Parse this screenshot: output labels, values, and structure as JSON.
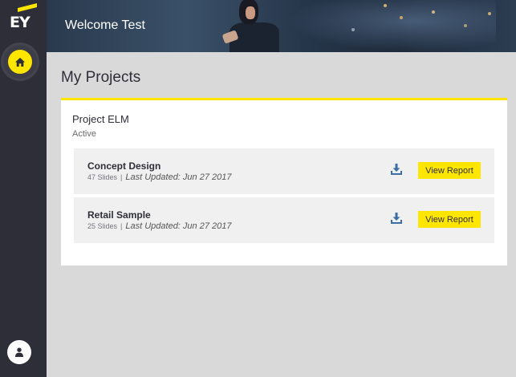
{
  "brand": {
    "logo_text": "EY",
    "accent_color": "#ffe600",
    "sidebar_color": "#2e2e38"
  },
  "sidebar": {
    "home_icon": "home-icon",
    "user_icon": "user-icon"
  },
  "header": {
    "welcome_text": "Welcome Test"
  },
  "main": {
    "title": "My Projects",
    "project": {
      "name": "Project ELM",
      "status": "Active",
      "reports": [
        {
          "title": "Concept Design",
          "slides": "47 Slides",
          "separator": "|",
          "updated": "Last Updated: Jun 27 2017",
          "download_icon": "download-icon",
          "button_label": "View Report"
        },
        {
          "title": "Retail Sample",
          "slides": "25 Slides",
          "separator": "|",
          "updated": "Last Updated: Jun 27 2017",
          "download_icon": "download-icon",
          "button_label": "View Report"
        }
      ]
    }
  }
}
